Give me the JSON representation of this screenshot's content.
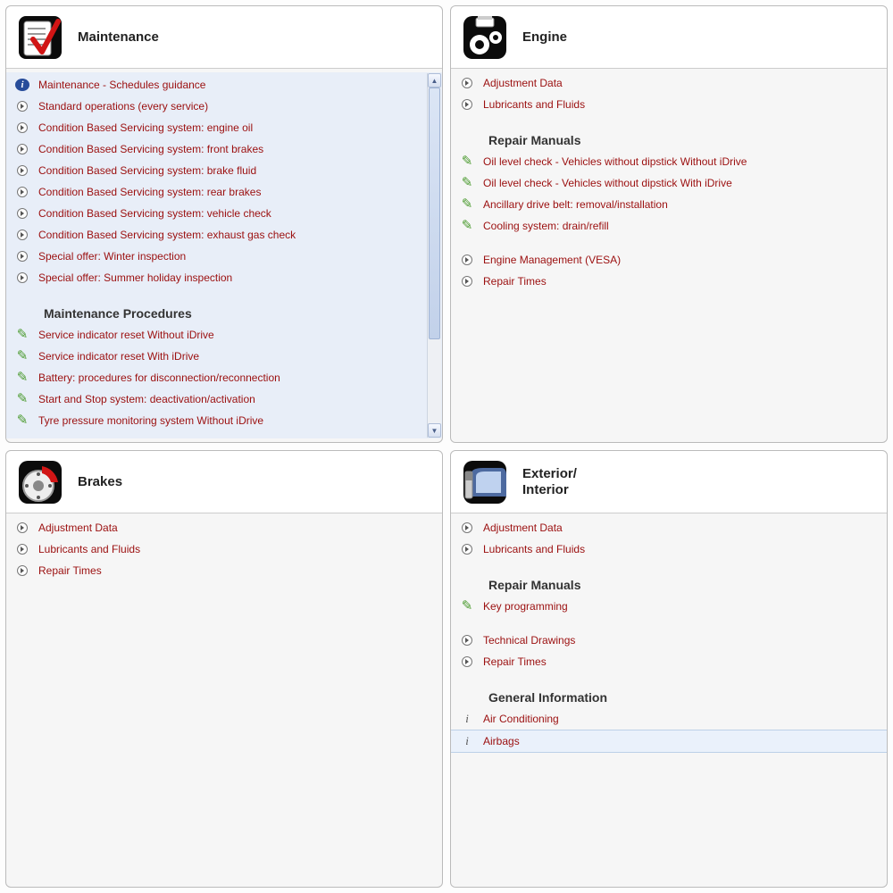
{
  "panels": {
    "maintenance": {
      "title": "Maintenance",
      "items": [
        {
          "icon": "info",
          "label": "Maintenance - Schedules guidance"
        },
        {
          "icon": "arrow",
          "label": "Standard operations (every service)"
        },
        {
          "icon": "arrow",
          "label": "Condition Based Servicing system: engine oil"
        },
        {
          "icon": "arrow",
          "label": "Condition Based Servicing system: front brakes"
        },
        {
          "icon": "arrow",
          "label": "Condition Based Servicing system: brake fluid"
        },
        {
          "icon": "arrow",
          "label": "Condition Based Servicing system: rear brakes"
        },
        {
          "icon": "arrow",
          "label": "Condition Based Servicing system: vehicle check"
        },
        {
          "icon": "arrow",
          "label": "Condition Based Servicing system: exhaust gas check"
        },
        {
          "icon": "arrow",
          "label": "Special offer: Winter inspection"
        },
        {
          "icon": "arrow",
          "label": "Special offer: Summer holiday inspection"
        }
      ],
      "sectionA": "Maintenance Procedures",
      "procs": [
        {
          "icon": "wrench",
          "label": "Service indicator reset Without iDrive"
        },
        {
          "icon": "wrench",
          "label": "Service indicator reset With iDrive"
        },
        {
          "icon": "wrench",
          "label": "Battery: procedures for disconnection/reconnection"
        },
        {
          "icon": "wrench",
          "label": "Start and Stop system: deactivation/activation"
        },
        {
          "icon": "wrench",
          "label": "Tyre pressure monitoring system Without iDrive"
        }
      ]
    },
    "engine": {
      "title": "Engine",
      "items": [
        {
          "icon": "arrow",
          "label": "Adjustment Data"
        },
        {
          "icon": "arrow",
          "label": "Lubricants and Fluids"
        }
      ],
      "sectionA": "Repair Manuals",
      "manuals": [
        {
          "icon": "wrench",
          "label": "Oil level check - Vehicles without dipstick Without iDrive"
        },
        {
          "icon": "wrench",
          "label": "Oil level check - Vehicles without dipstick With iDrive"
        },
        {
          "icon": "wrench",
          "label": "Ancillary drive belt: removal/installation"
        },
        {
          "icon": "wrench",
          "label": "Cooling system: drain/refill"
        }
      ],
      "more": [
        {
          "icon": "arrow",
          "label": "Engine Management (VESA)"
        },
        {
          "icon": "arrow",
          "label": "Repair Times"
        }
      ]
    },
    "brakes": {
      "title": "Brakes",
      "items": [
        {
          "icon": "arrow",
          "label": "Adjustment Data"
        },
        {
          "icon": "arrow",
          "label": "Lubricants and Fluids"
        },
        {
          "icon": "arrow",
          "label": "Repair Times"
        }
      ]
    },
    "exterior": {
      "title": "Exterior/\nInterior",
      "items": [
        {
          "icon": "arrow",
          "label": "Adjustment Data"
        },
        {
          "icon": "arrow",
          "label": "Lubricants and Fluids"
        }
      ],
      "sectionA": "Repair Manuals",
      "manuals": [
        {
          "icon": "wrench",
          "label": "Key programming"
        }
      ],
      "more": [
        {
          "icon": "arrow",
          "label": "Technical Drawings"
        },
        {
          "icon": "arrow",
          "label": "Repair Times"
        }
      ],
      "sectionB": "General Information",
      "general": [
        {
          "icon": "iital",
          "label": "Air Conditioning"
        },
        {
          "icon": "iital",
          "label": "Airbags",
          "selected": true
        }
      ]
    }
  }
}
